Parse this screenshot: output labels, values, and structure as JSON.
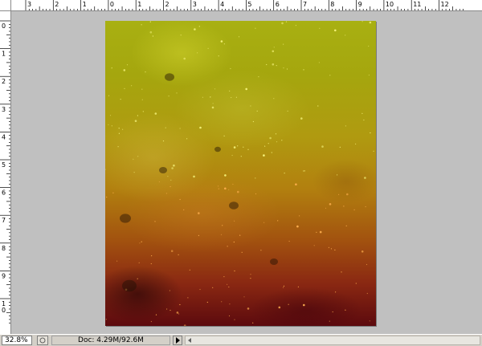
{
  "ruler": {
    "horizontal_labels": [
      "3",
      "2",
      "1",
      "0",
      "1",
      "2",
      "3",
      "4",
      "5",
      "6",
      "7",
      "8",
      "9",
      "10",
      "11",
      "12"
    ],
    "vertical_labels": [
      "0",
      "1",
      "2",
      "3",
      "4",
      "5",
      "6",
      "7",
      "8",
      "9",
      "10"
    ]
  },
  "document": {
    "icon": "nebula-image"
  },
  "statusbar": {
    "zoom": "32.8%",
    "status_icon": "document-status-icon",
    "doc_info": "Doc: 4.29M/92.6M"
  }
}
